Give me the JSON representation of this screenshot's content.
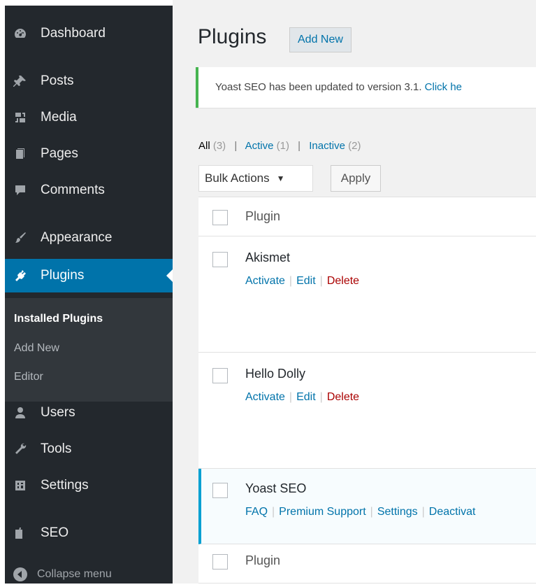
{
  "sidebar": {
    "items": [
      {
        "label": "Dashboard",
        "icon": "dashboard-icon"
      },
      {
        "label": "Posts",
        "icon": "pin-icon"
      },
      {
        "label": "Media",
        "icon": "media-icon"
      },
      {
        "label": "Pages",
        "icon": "pages-icon"
      },
      {
        "label": "Comments",
        "icon": "comment-icon"
      },
      {
        "label": "Appearance",
        "icon": "brush-icon"
      },
      {
        "label": "Plugins",
        "icon": "plug-icon"
      },
      {
        "label": "Users",
        "icon": "user-icon"
      },
      {
        "label": "Tools",
        "icon": "wrench-icon"
      },
      {
        "label": "Settings",
        "icon": "settings-icon"
      },
      {
        "label": "SEO",
        "icon": "yoast-icon"
      }
    ],
    "submenu": [
      "Installed Plugins",
      "Add New",
      "Editor"
    ],
    "collapse_label": "Collapse menu",
    "active_color": "#0073aa"
  },
  "header": {
    "title": "Plugins",
    "add_new": "Add New"
  },
  "notice": {
    "text": "Yoast SEO has been updated to version 3.1.",
    "link": "Click he"
  },
  "views": {
    "all": "All",
    "all_count": "(3)",
    "active": "Active",
    "active_count": "(1)",
    "inactive": "Inactive",
    "inactive_count": "(2)",
    "sep": "|"
  },
  "bulk": {
    "selected": "Bulk Actions",
    "apply": "Apply"
  },
  "table": {
    "column_header": "Plugin",
    "plugins": [
      {
        "name": "Akismet",
        "actions": [
          "Activate",
          "Edit",
          "Delete"
        ]
      },
      {
        "name": "Hello Dolly",
        "actions": [
          "Activate",
          "Edit",
          "Delete"
        ]
      },
      {
        "name": "Yoast SEO",
        "actions": [
          "FAQ",
          "Premium Support",
          "Settings",
          "Deactivat"
        ]
      }
    ],
    "footer_header": "Plugin"
  }
}
